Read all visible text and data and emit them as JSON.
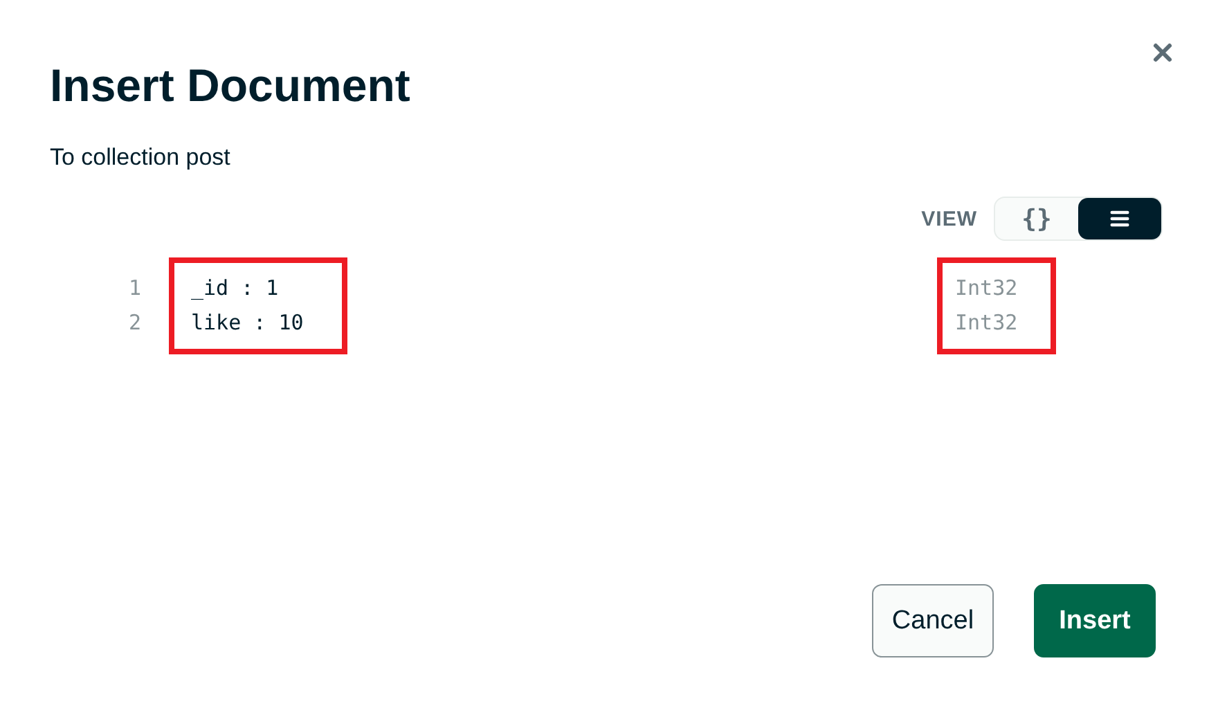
{
  "dialog": {
    "title": "Insert Document",
    "subtitle": "To collection post"
  },
  "view_toggle": {
    "label": "VIEW",
    "options": [
      {
        "kind": "json",
        "label": "{}",
        "selected": false
      },
      {
        "kind": "list",
        "selected": true
      }
    ]
  },
  "document": {
    "fields_highlighted": true,
    "types_highlighted": true,
    "rows": [
      {
        "line": "1",
        "text": "_id : 1",
        "type": "Int32"
      },
      {
        "line": "2",
        "text": "like : 10",
        "type": "Int32"
      }
    ]
  },
  "buttons": [
    {
      "kind": "secondary",
      "label": "Cancel"
    },
    {
      "kind": "primary",
      "label": "Insert"
    }
  ]
}
